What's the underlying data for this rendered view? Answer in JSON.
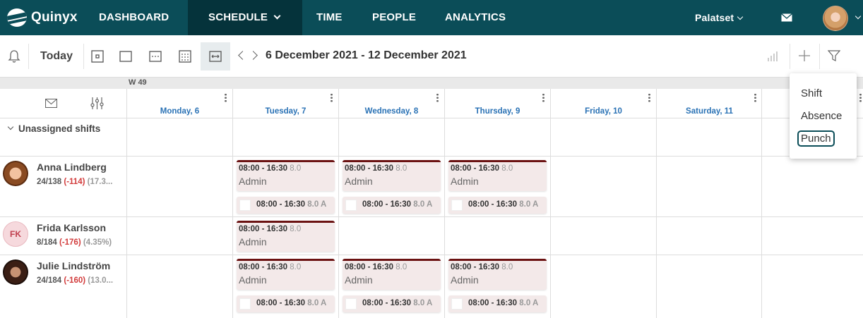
{
  "brand": {
    "name": "Quinyx"
  },
  "nav": {
    "items": [
      {
        "label": "DASHBOARD"
      },
      {
        "label": "SCHEDULE"
      },
      {
        "label": "TIME"
      },
      {
        "label": "PEOPLE"
      },
      {
        "label": "ANALYTICS"
      }
    ],
    "active": "SCHEDULE",
    "unit_selector": "Palatset"
  },
  "toolbar": {
    "today_label": "Today",
    "date_range": "6 December 2021 - 12 December 2021"
  },
  "grid": {
    "week_label": "W 49",
    "days": [
      "Monday, 6",
      "Tuesday, 7",
      "Wednesday, 8",
      "Thursday, 9",
      "Friday, 10",
      "Saturday, 11"
    ],
    "unassigned_label": "Unassigned shifts",
    "employees": [
      {
        "name": "Anna Lindberg",
        "stats_main": "24/138",
        "stats_diff": "(-114)",
        "stats_pct": "(17.3..."
      },
      {
        "name": "Frida Karlsson",
        "initials": "FK",
        "stats_main": "8/184",
        "stats_diff": "(-176)",
        "stats_pct": "(4.35%)"
      },
      {
        "name": "Julie Lindström",
        "stats_main": "24/184",
        "stats_diff": "(-160)",
        "stats_pct": "(13.0..."
      }
    ],
    "shift": {
      "time": "08:00 - 16:30",
      "hours": "8.0",
      "role": "Admin",
      "punch_hours": "8.0 A"
    }
  },
  "add_menu": {
    "items": [
      "Shift",
      "Absence",
      "Punch"
    ],
    "focused": "Punch"
  },
  "colors": {
    "nav_bg": "#0b4d58",
    "nav_active": "#05333b",
    "day_header": "#2a72b5",
    "shift_bar": "#6b1212",
    "negative": "#d23b3b"
  }
}
